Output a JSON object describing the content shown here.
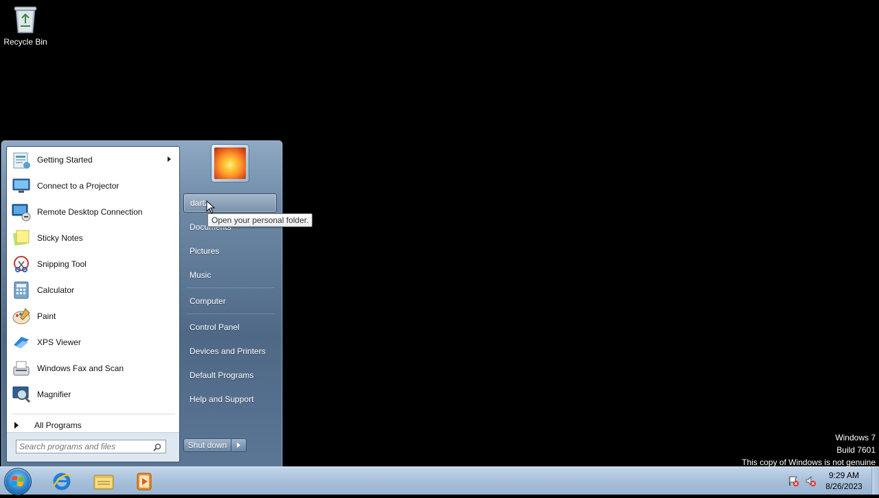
{
  "desktop": {
    "recycle_bin_label": "Recycle Bin",
    "watermark": {
      "line1": "Windows 7",
      "line2": "Build 7601",
      "line3": "This copy of Windows is not genuine"
    }
  },
  "start_menu": {
    "programs": [
      {
        "label": "Getting Started",
        "icon": "getting-started-icon",
        "has_submenu": true
      },
      {
        "label": "Connect to a Projector",
        "icon": "projector-icon"
      },
      {
        "label": "Remote Desktop Connection",
        "icon": "remote-desktop-icon"
      },
      {
        "label": "Sticky Notes",
        "icon": "sticky-notes-icon"
      },
      {
        "label": "Snipping Tool",
        "icon": "snipping-tool-icon"
      },
      {
        "label": "Calculator",
        "icon": "calculator-icon"
      },
      {
        "label": "Paint",
        "icon": "paint-icon"
      },
      {
        "label": "XPS Viewer",
        "icon": "xps-viewer-icon"
      },
      {
        "label": "Windows Fax and Scan",
        "icon": "fax-scan-icon"
      },
      {
        "label": "Magnifier",
        "icon": "magnifier-icon"
      }
    ],
    "all_programs_label": "All Programs",
    "search_placeholder": "Search programs and files",
    "right_items": {
      "user": "dartz",
      "documents": "Documents",
      "pictures": "Pictures",
      "music": "Music",
      "computer": "Computer",
      "control_panel": "Control Panel",
      "devices_printers": "Devices and Printers",
      "default_programs": "Default Programs",
      "help_support": "Help and Support"
    },
    "shutdown_label": "Shut down",
    "tooltip": "Open your personal folder."
  },
  "taskbar": {
    "apps": [
      "internet-explorer-icon",
      "windows-explorer-icon",
      "media-player-icon"
    ],
    "clock": {
      "time": "9:29 AM",
      "date": "8/26/2023"
    }
  }
}
